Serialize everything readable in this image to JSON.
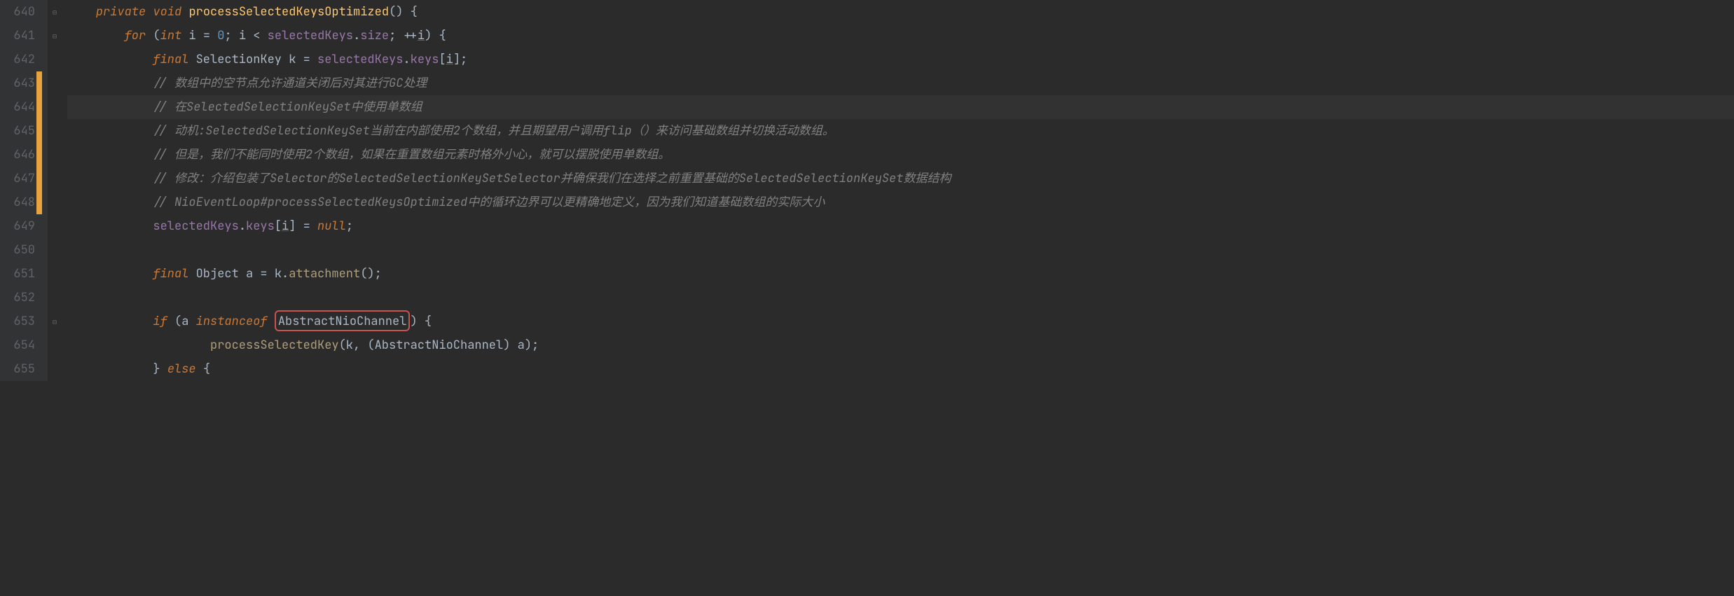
{
  "lines": {
    "640": "640",
    "641": "641",
    "642": "642",
    "643": "643",
    "644": "644",
    "645": "645",
    "646": "646",
    "647": "647",
    "648": "648",
    "649": "649",
    "650": "650",
    "651": "651",
    "652": "652",
    "653": "653",
    "654": "654",
    "655": "655"
  },
  "code": {
    "l640": {
      "private": "private",
      "void": "void",
      "method": "processSelectedKeysOptimized",
      "paren": "() {"
    },
    "l641": {
      "indent": "        ",
      "for": "for",
      "open": " (",
      "int": "int",
      "i1": " i ",
      "eq": "= ",
      "zero": "0",
      "semi1": "; ",
      "i2": "i",
      "lt": " < ",
      "selkeys": "selectedKeys",
      "dot": ".",
      "size": "size",
      "semi2": "; ++",
      "i3": "i",
      "close": ") {"
    },
    "l642": {
      "indent": "            ",
      "final": "final",
      "sp": " ",
      "type": "SelectionKey",
      "var": " k = ",
      "selkeys": "selectedKeys",
      "dot1": ".",
      "keys": "keys",
      "br": "[",
      "i": "i",
      "close": "];"
    },
    "l643": {
      "indent": "            ",
      "comment": "// 数组中的空节点允许通道关闭后对其进行GC处理"
    },
    "l644": {
      "indent": "            ",
      "comment": "// 在SelectedSelectionKeySet中使用单数组"
    },
    "l645": {
      "indent": "            ",
      "comment": "// 动机:SelectedSelectionKeySet当前在内部使用2个数组，并且期望用户调用flip（）来访问基础数组并切换活动数组。"
    },
    "l646": {
      "indent": "            ",
      "comment": "// 但是，我们不能同时使用2个数组，如果在重置数组元素时格外小心，就可以摆脱使用单数组。"
    },
    "l647": {
      "indent": "            ",
      "comment": "// 修改：介绍包装了Selector的SelectedSelectionKeySetSelector并确保我们在选择之前重置基础的SelectedSelectionKeySet数据结构"
    },
    "l648": {
      "indent": "            ",
      "comment": "// NioEventLoop#processSelectedKeysOptimized中的循环边界可以更精确地定义，因为我们知道基础数组的实际大小"
    },
    "l649": {
      "indent": "            ",
      "selkeys": "selectedKeys",
      "dot": ".",
      "keys": "keys",
      "br": "[",
      "i": "i",
      "close": "] = ",
      "null": "null",
      "semi": ";"
    },
    "l651": {
      "indent": "            ",
      "final": "final",
      "type": " Object ",
      "a": "a",
      "eq": " = k.",
      "method": "attachment",
      "paren": "();"
    },
    "l653": {
      "indent": "            ",
      "if": "if",
      "open": " (a ",
      "instanceof": "instanceof",
      "sp": " ",
      "type": "AbstractNioChannel",
      "close": ") {"
    },
    "l654": {
      "indent": "                    ",
      "method": "processSelectedKey",
      "open": "(k, (",
      "type": "AbstractNioChannel",
      "close": ") a);"
    },
    "l655": {
      "indent": "            } ",
      "else": "else",
      "brace": " {"
    }
  }
}
